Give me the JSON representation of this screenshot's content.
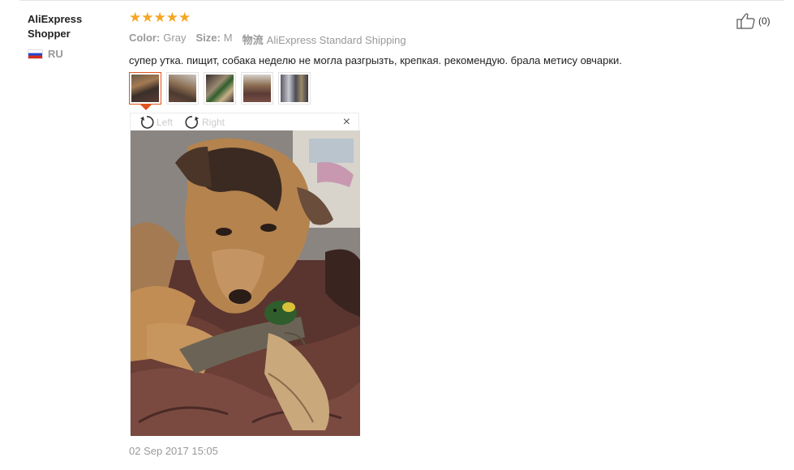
{
  "reviewer": {
    "name": "AliExpress Shopper",
    "country_code": "RU"
  },
  "review": {
    "stars": "★★★★★",
    "rating_value": 5,
    "rating_max": 5,
    "color_label": "Color:",
    "color_value": "Gray",
    "size_label": "Size:",
    "size_value": "M",
    "shipping_label": "物流",
    "shipping_value": "AliExpress Standard Shipping",
    "text": "супер утка. пищит, собака неделю не могла разгрызть, крепкая. рекомендую. брала метису овчарки.",
    "date": "02 Sep 2017 15:05"
  },
  "helpful": {
    "count": "(0)",
    "icon": "thumbs-up-icon"
  },
  "viewer": {
    "rotate_left_label": "Left",
    "rotate_right_label": "Right",
    "close_symbol": "×",
    "thumbnail_count": 5,
    "active_index": 0
  },
  "colors": {
    "star": "#f5a623",
    "accent": "#e0531c",
    "muted": "#999999"
  }
}
